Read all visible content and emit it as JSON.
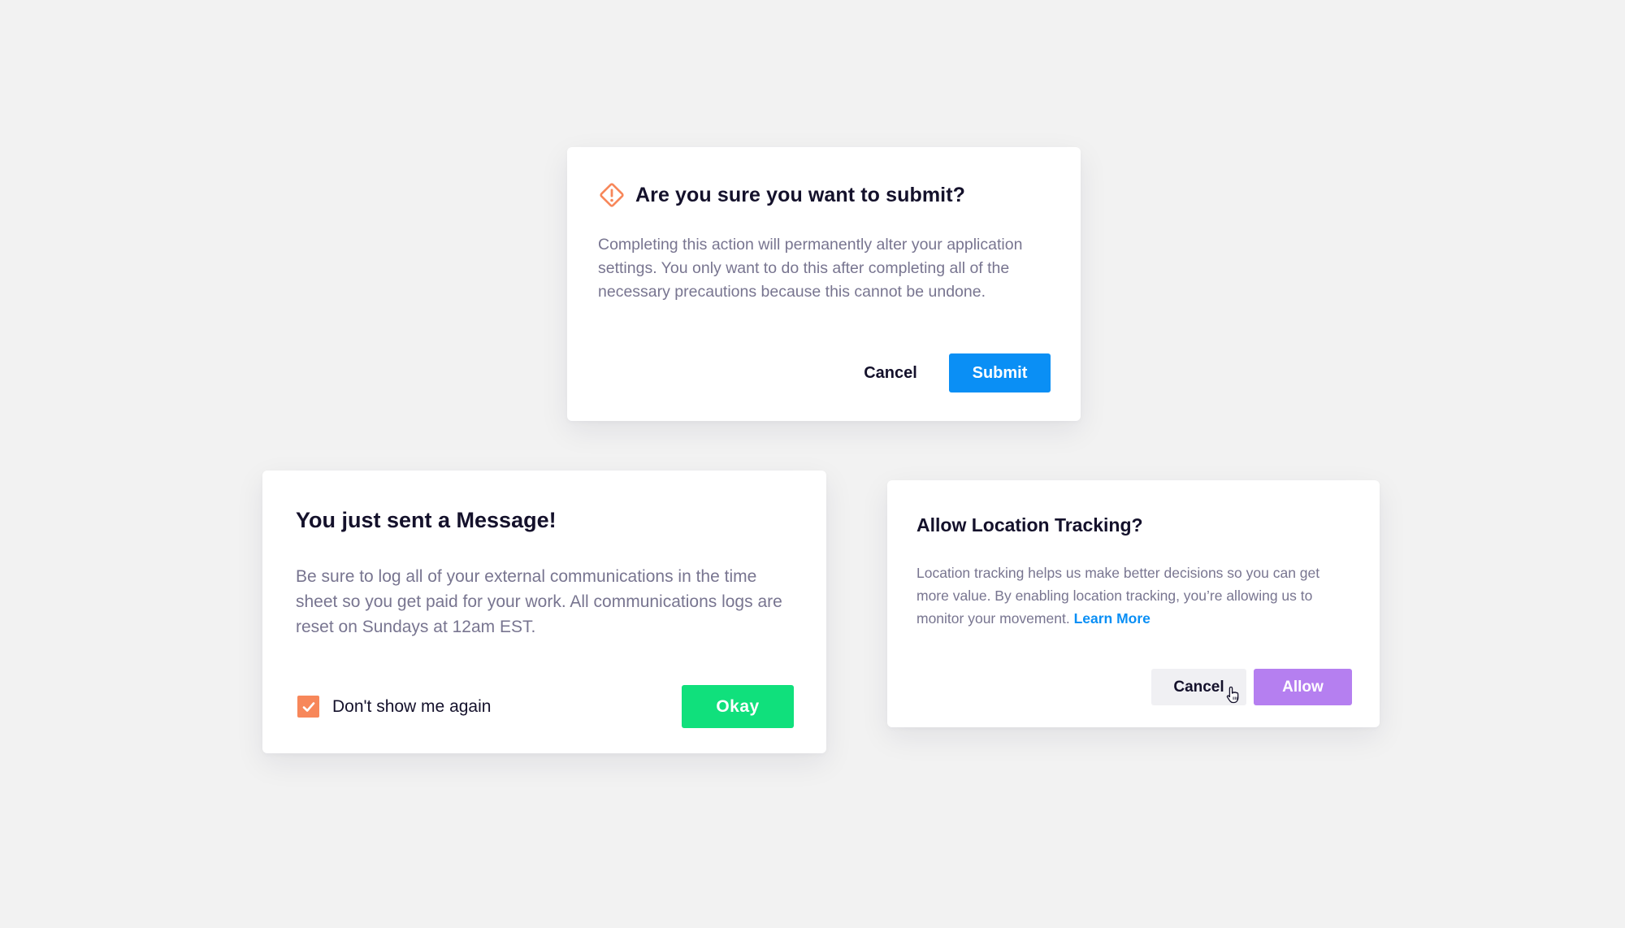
{
  "submit_dialog": {
    "title": "Are you sure you want to submit?",
    "icon": "warning-diamond-icon",
    "body": "Completing this action will permanently alter your application settings. You only want to do this after completing all of the necessary precautions because this cannot be undone.",
    "cancel_label": "Cancel",
    "submit_label": "Submit",
    "colors": {
      "icon": "#f7875a",
      "primary": "#0a8ff5"
    }
  },
  "message_dialog": {
    "title": "You just sent a Message!",
    "body": "Be sure to log all of your external communications in the time sheet so you get paid for your work. All communications logs are reset on Sundays at 12am EST.",
    "checkbox_label": "Don't show me again",
    "checkbox_checked": true,
    "okay_label": "Okay",
    "colors": {
      "checkbox": "#f7875a",
      "primary": "#10e07c"
    }
  },
  "location_dialog": {
    "title": "Allow Location Tracking?",
    "body": "Location tracking helps us make better decisions so you can get more value. By enabling location tracking, you’re allowing us to monitor your movement.",
    "learn_more_label": "Learn More",
    "cancel_label": "Cancel",
    "allow_label": "Allow",
    "cursor_icon": "hand-pointer-icon",
    "colors": {
      "link": "#0a8ff5",
      "primary": "#b57ff0"
    }
  }
}
